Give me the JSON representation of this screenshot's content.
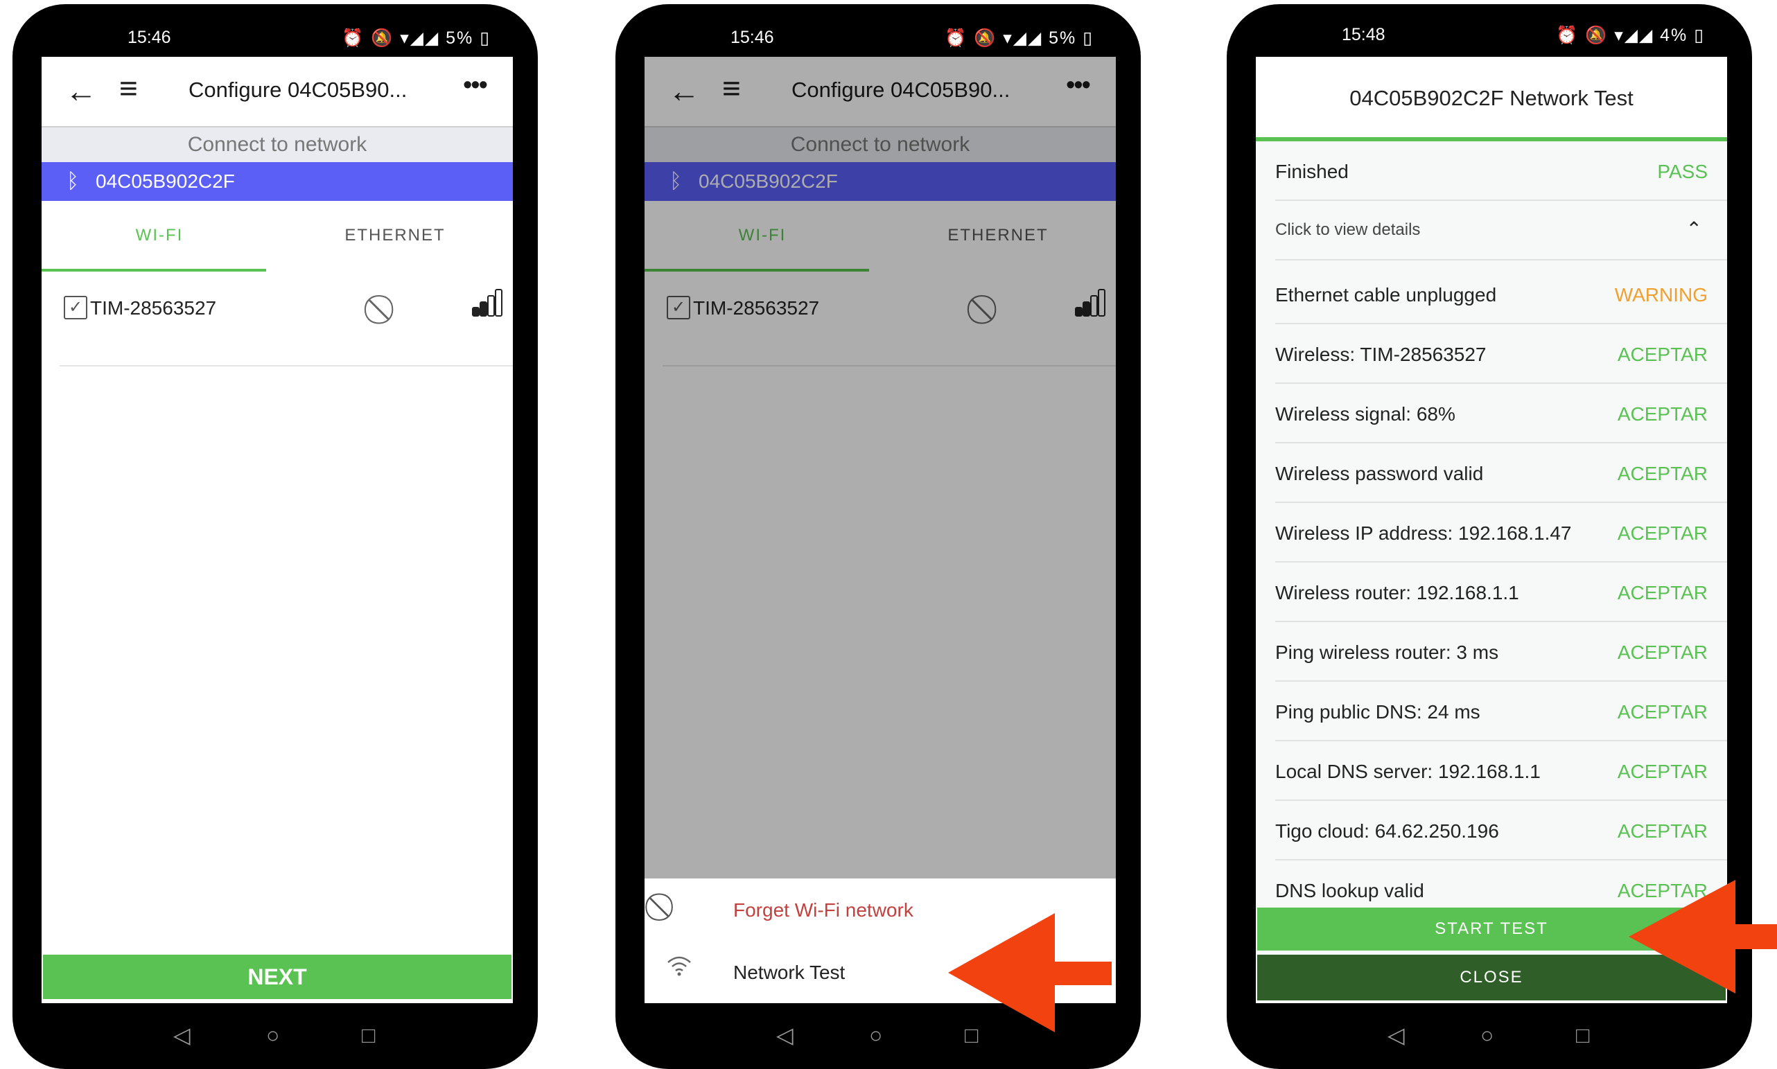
{
  "phone1": {
    "status": {
      "time": "15:46",
      "icons": "⏰ 🔕 ▾◢◢ 5% ▯"
    },
    "header": {
      "title": "Configure 04C05B90..."
    },
    "connect_label": "Connect to network",
    "device_name": "04C05B902C2F",
    "tabs": {
      "wifi": "WI-FI",
      "ethernet": "ETHERNET"
    },
    "network": {
      "ssid": "TIM-28563527"
    },
    "next_label": "NEXT"
  },
  "phone2": {
    "status": {
      "time": "15:46",
      "icons": "⏰ 🔕 ▾◢◢ 5% ▯"
    },
    "header": {
      "title": "Configure 04C05B90..."
    },
    "connect_label": "Connect to network",
    "device_name": "04C05B902C2F",
    "tabs": {
      "wifi": "WI-FI",
      "ethernet": "ETHERNET"
    },
    "network": {
      "ssid": "TIM-28563527"
    },
    "sheet": {
      "forget": "Forget Wi-Fi network",
      "network_test": "Network Test"
    }
  },
  "phone3": {
    "status": {
      "time": "15:48",
      "icons": "⏰ 🔕 ▾◢◢ 4% ▯"
    },
    "title": "04C05B902C2F Network Test",
    "summary": {
      "label": "Finished",
      "status": "PASS"
    },
    "details_label": "Click to view details",
    "results": [
      {
        "label": "Ethernet cable unplugged",
        "status": "WARNING"
      },
      {
        "label": "Wireless: TIM-28563527",
        "status": "ACEPTAR"
      },
      {
        "label": "Wireless signal: 68%",
        "status": "ACEPTAR"
      },
      {
        "label": "Wireless password valid",
        "status": "ACEPTAR"
      },
      {
        "label": "Wireless IP address: 192.168.1.47",
        "status": "ACEPTAR"
      },
      {
        "label": "Wireless router: 192.168.1.1",
        "status": "ACEPTAR"
      },
      {
        "label": "Ping wireless router: 3 ms",
        "status": "ACEPTAR"
      },
      {
        "label": "Ping public DNS: 24 ms",
        "status": "ACEPTAR"
      },
      {
        "label": "Local DNS server: 192.168.1.1",
        "status": "ACEPTAR"
      },
      {
        "label": "Tigo cloud: 64.62.250.196",
        "status": "ACEPTAR"
      },
      {
        "label": "DNS lookup valid",
        "status": "ACEPTAR"
      }
    ],
    "start_label": "START TEST",
    "close_label": "CLOSE"
  },
  "colors": {
    "accent_green": "#5ac153",
    "device_blue": "#5b5ff5",
    "warning_orange": "#f0a030",
    "arrow_red": "#f2420f",
    "close_dark_green": "#2f5e28"
  }
}
